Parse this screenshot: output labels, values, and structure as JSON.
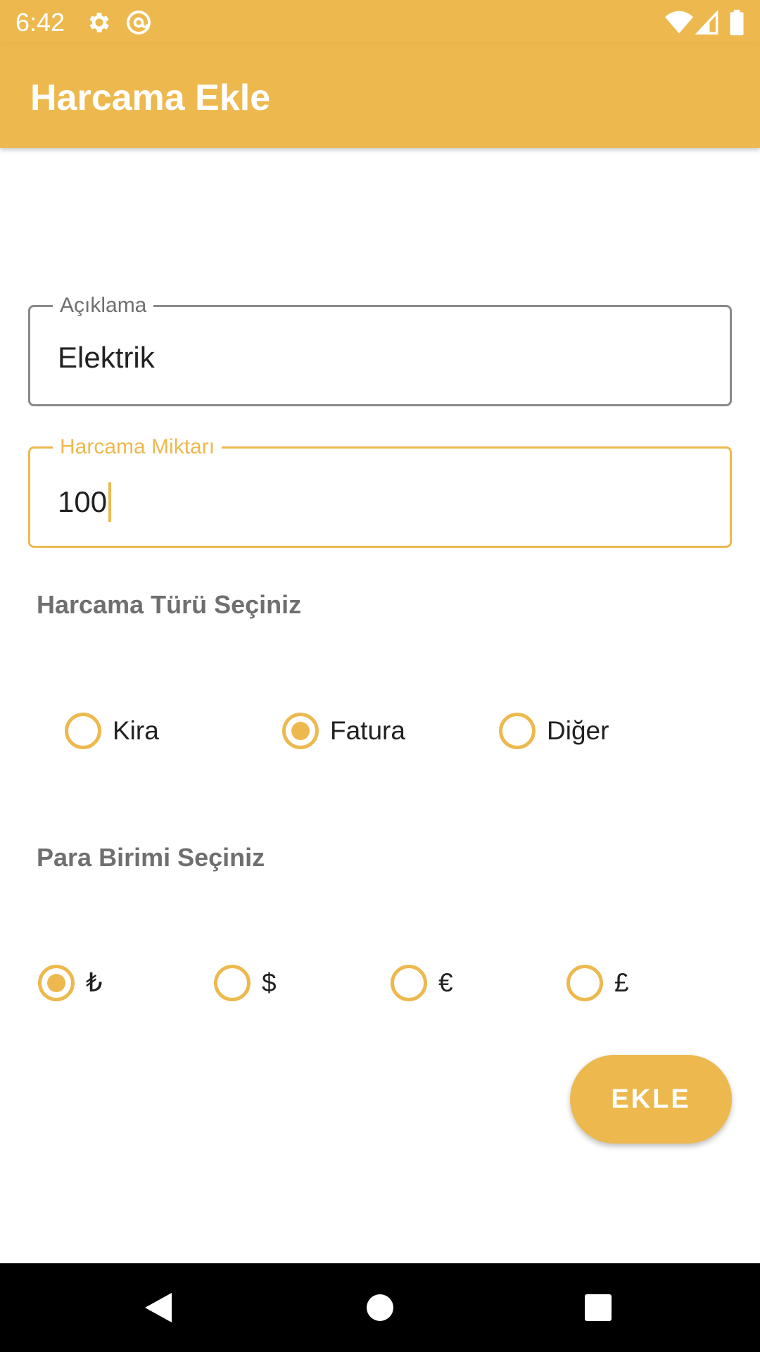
{
  "status_bar": {
    "time": "6:42",
    "icons": [
      "gear-icon",
      "at-sign-icon",
      "wifi-icon",
      "cellular-signal-icon",
      "battery-icon"
    ]
  },
  "app_bar": {
    "title": "Harcama Ekle"
  },
  "form": {
    "description": {
      "label": "Açıklama",
      "value": "Elektrik"
    },
    "amount": {
      "label": "Harcama Miktarı",
      "value": "100",
      "focused": true
    },
    "expense_type": {
      "title": "Harcama Türü Seçiniz",
      "options": [
        {
          "label": "Kira",
          "checked": false
        },
        {
          "label": "Fatura",
          "checked": true
        },
        {
          "label": "Diğer",
          "checked": false
        }
      ]
    },
    "currency": {
      "title": "Para Birimi Seçiniz",
      "options": [
        {
          "label": "₺",
          "checked": true
        },
        {
          "label": "$",
          "checked": false
        },
        {
          "label": "€",
          "checked": false
        },
        {
          "label": "£",
          "checked": false
        }
      ]
    },
    "submit_label": "EKLE"
  },
  "nav_bar": {
    "icons": [
      "back-triangle-icon",
      "home-circle-icon",
      "recents-square-icon"
    ]
  },
  "colors": {
    "accent": "#EDB94F",
    "nav_background": "#000000",
    "text_primary": "#212121",
    "text_secondary": "#6f6f6f"
  }
}
